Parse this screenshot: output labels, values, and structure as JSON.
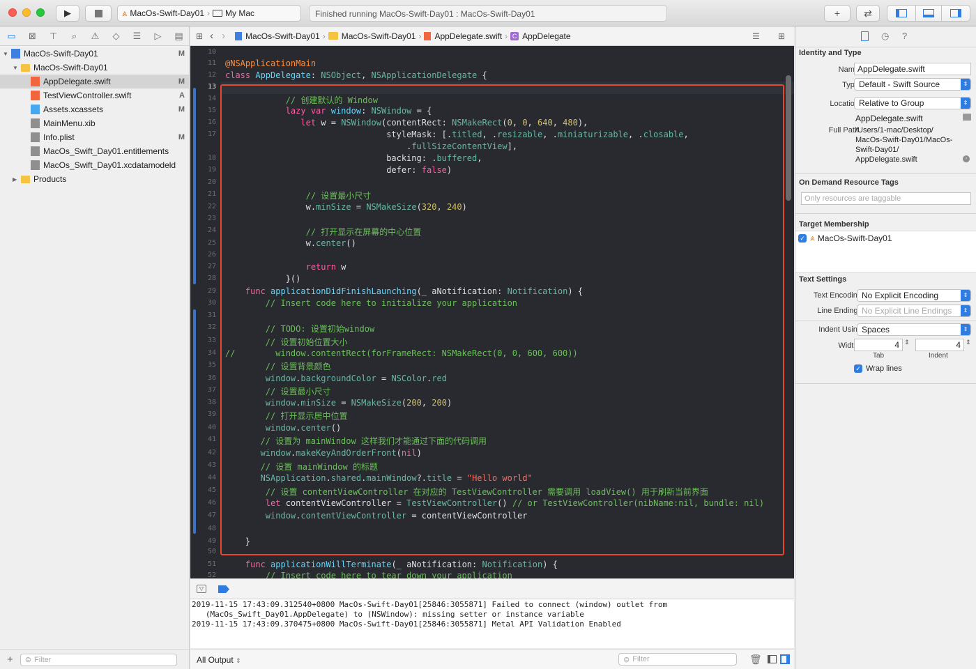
{
  "toolbar": {
    "scheme": "MacOs-Swift-Day01",
    "destination": "My Mac",
    "status": "Finished running MacOs-Swift-Day01 : MacOs-Swift-Day01"
  },
  "navigator": {
    "items": [
      {
        "label": "MacOs-Swift-Day01",
        "badge": "M",
        "indent": 0,
        "icon": "project"
      },
      {
        "label": "MacOs-Swift-Day01",
        "badge": "",
        "indent": 1,
        "icon": "folder"
      },
      {
        "label": "AppDelegate.swift",
        "badge": "M",
        "indent": 2,
        "icon": "swift"
      },
      {
        "label": "TestViewController.swift",
        "badge": "A",
        "indent": 2,
        "icon": "swift"
      },
      {
        "label": "Assets.xcassets",
        "badge": "M",
        "indent": 2,
        "icon": "assets"
      },
      {
        "label": "MainMenu.xib",
        "badge": "",
        "indent": 2,
        "icon": "xib"
      },
      {
        "label": "Info.plist",
        "badge": "M",
        "indent": 2,
        "icon": "plist"
      },
      {
        "label": "MacOs_Swift_Day01.entitlements",
        "badge": "",
        "indent": 2,
        "icon": "file"
      },
      {
        "label": "MacOs_Swift_Day01.xcdatamodeld",
        "badge": "",
        "indent": 2,
        "icon": "file"
      },
      {
        "label": "Products",
        "badge": "",
        "indent": 1,
        "icon": "folder"
      }
    ],
    "filter_placeholder": "Filter"
  },
  "jumpbar": {
    "crumb1": "MacOs-Swift-Day01",
    "crumb2": "MacOs-Swift-Day01",
    "crumb3": "AppDelegate.swift",
    "crumb4": "AppDelegate"
  },
  "code_lines": [
    {
      "n": "10",
      "segs": []
    },
    {
      "n": "11",
      "segs": [
        [
          "a",
          "@NSApplicationMain"
        ]
      ]
    },
    {
      "n": "12",
      "segs": [
        [
          "k",
          "class"
        ],
        [
          "w",
          " "
        ],
        [
          "t",
          "AppDelegate"
        ],
        [
          "w",
          ": "
        ],
        [
          "f",
          "NSObject"
        ],
        [
          "w",
          ", "
        ],
        [
          "f",
          "NSApplicationDelegate"
        ],
        [
          "w",
          " {"
        ]
      ]
    },
    {
      "n": "13",
      "segs": []
    },
    {
      "n": "14",
      "segs": [
        [
          "w",
          "            "
        ],
        [
          "c",
          "// 创建默认的 Window"
        ]
      ]
    },
    {
      "n": "15",
      "segs": [
        [
          "w",
          "            "
        ],
        [
          "k",
          "lazy var"
        ],
        [
          "w",
          " "
        ],
        [
          "t",
          "window"
        ],
        [
          "w",
          ": "
        ],
        [
          "f",
          "NSWindow"
        ],
        [
          "w",
          " = {"
        ]
      ]
    },
    {
      "n": "16",
      "segs": [
        [
          "w",
          "               "
        ],
        [
          "k",
          "let"
        ],
        [
          "w",
          " w = "
        ],
        [
          "f",
          "NSWindow"
        ],
        [
          "w",
          "(contentRect: "
        ],
        [
          "f",
          "NSMakeRect"
        ],
        [
          "w",
          "("
        ],
        [
          "n",
          "0"
        ],
        [
          "w",
          ", "
        ],
        [
          "n",
          "0"
        ],
        [
          "w",
          ", "
        ],
        [
          "n",
          "640"
        ],
        [
          "w",
          ", "
        ],
        [
          "n",
          "480"
        ],
        [
          "w",
          "),"
        ]
      ]
    },
    {
      "n": "17",
      "segs": [
        [
          "w",
          "                                styleMask: [."
        ],
        [
          "f",
          "titled"
        ],
        [
          "w",
          ", ."
        ],
        [
          "f",
          "resizable"
        ],
        [
          "w",
          ", ."
        ],
        [
          "f",
          "miniaturizable"
        ],
        [
          "w",
          ", ."
        ],
        [
          "f",
          "closable"
        ],
        [
          "w",
          ","
        ]
      ]
    },
    {
      "n": "",
      "segs": [
        [
          "w",
          "                                    ."
        ],
        [
          "f",
          "fullSizeContentView"
        ],
        [
          "w",
          "],"
        ]
      ]
    },
    {
      "n": "18",
      "segs": [
        [
          "w",
          "                                backing: ."
        ],
        [
          "f",
          "buffered"
        ],
        [
          "w",
          ","
        ]
      ]
    },
    {
      "n": "19",
      "segs": [
        [
          "w",
          "                                defer: "
        ],
        [
          "k",
          "false"
        ],
        [
          "w",
          ")"
        ]
      ]
    },
    {
      "n": "20",
      "segs": []
    },
    {
      "n": "21",
      "segs": [
        [
          "w",
          "                "
        ],
        [
          "c",
          "// 设置最小尺寸"
        ]
      ]
    },
    {
      "n": "22",
      "segs": [
        [
          "w",
          "                w."
        ],
        [
          "f",
          "minSize"
        ],
        [
          "w",
          " = "
        ],
        [
          "f",
          "NSMakeSize"
        ],
        [
          "w",
          "("
        ],
        [
          "n",
          "320"
        ],
        [
          "w",
          ", "
        ],
        [
          "n",
          "240"
        ],
        [
          "w",
          ")"
        ]
      ]
    },
    {
      "n": "23",
      "segs": []
    },
    {
      "n": "24",
      "segs": [
        [
          "w",
          "                "
        ],
        [
          "c",
          "// 打开显示在屏幕的中心位置"
        ]
      ]
    },
    {
      "n": "25",
      "segs": [
        [
          "w",
          "                w."
        ],
        [
          "f",
          "center"
        ],
        [
          "w",
          "()"
        ]
      ]
    },
    {
      "n": "26",
      "segs": []
    },
    {
      "n": "27",
      "segs": [
        [
          "w",
          "                "
        ],
        [
          "k",
          "return"
        ],
        [
          "w",
          " w"
        ]
      ]
    },
    {
      "n": "28",
      "segs": [
        [
          "w",
          "            }()"
        ]
      ]
    },
    {
      "n": "29",
      "segs": [
        [
          "w",
          "    "
        ],
        [
          "k",
          "func"
        ],
        [
          "w",
          " "
        ],
        [
          "t",
          "applicationDidFinishLaunching"
        ],
        [
          "w",
          "(_ aNotification: "
        ],
        [
          "f",
          "Notification"
        ],
        [
          "w",
          ") {"
        ]
      ]
    },
    {
      "n": "30",
      "segs": [
        [
          "w",
          "        "
        ],
        [
          "c",
          "// Insert code here to initialize your application"
        ]
      ]
    },
    {
      "n": "31",
      "segs": []
    },
    {
      "n": "32",
      "segs": [
        [
          "w",
          "        "
        ],
        [
          "c",
          "// TODO: 设置初始window"
        ]
      ]
    },
    {
      "n": "33",
      "segs": [
        [
          "w",
          "        "
        ],
        [
          "c",
          "// 设置初始位置大小"
        ]
      ]
    },
    {
      "n": "34",
      "segs": [
        [
          "c",
          "//        window.contentRect(forFrameRect: NSMakeRect(0, 0, 600, 600))"
        ]
      ]
    },
    {
      "n": "35",
      "segs": [
        [
          "w",
          "        "
        ],
        [
          "c",
          "// 设置背景颜色"
        ]
      ]
    },
    {
      "n": "36",
      "segs": [
        [
          "w",
          "        "
        ],
        [
          "f",
          "window"
        ],
        [
          "w",
          "."
        ],
        [
          "f",
          "backgroundColor"
        ],
        [
          "w",
          " = "
        ],
        [
          "f",
          "NSColor"
        ],
        [
          "w",
          "."
        ],
        [
          "f",
          "red"
        ]
      ]
    },
    {
      "n": "37",
      "segs": [
        [
          "w",
          "        "
        ],
        [
          "c",
          "// 设置最小尺寸"
        ]
      ]
    },
    {
      "n": "38",
      "segs": [
        [
          "w",
          "        "
        ],
        [
          "f",
          "window"
        ],
        [
          "w",
          "."
        ],
        [
          "f",
          "minSize"
        ],
        [
          "w",
          " = "
        ],
        [
          "f",
          "NSMakeSize"
        ],
        [
          "w",
          "("
        ],
        [
          "n",
          "200"
        ],
        [
          "w",
          ", "
        ],
        [
          "n",
          "200"
        ],
        [
          "w",
          ")"
        ]
      ]
    },
    {
      "n": "39",
      "segs": [
        [
          "w",
          "        "
        ],
        [
          "c",
          "// 打开显示居中位置"
        ]
      ]
    },
    {
      "n": "40",
      "segs": [
        [
          "w",
          "        "
        ],
        [
          "f",
          "window"
        ],
        [
          "w",
          "."
        ],
        [
          "f",
          "center"
        ],
        [
          "w",
          "()"
        ]
      ]
    },
    {
      "n": "41",
      "segs": [
        [
          "w",
          "       "
        ],
        [
          "c",
          "// 设置为 mainWindow 这样我们才能通过下面的代码调用"
        ]
      ]
    },
    {
      "n": "42",
      "segs": [
        [
          "w",
          "       "
        ],
        [
          "f",
          "window"
        ],
        [
          "w",
          "."
        ],
        [
          "f",
          "makeKeyAndOrderFront"
        ],
        [
          "w",
          "("
        ],
        [
          "k",
          "nil"
        ],
        [
          "w",
          ")"
        ]
      ]
    },
    {
      "n": "43",
      "segs": [
        [
          "w",
          "       "
        ],
        [
          "c",
          "// 设置 mainWindow 的标题"
        ]
      ]
    },
    {
      "n": "44",
      "segs": [
        [
          "w",
          "       "
        ],
        [
          "f",
          "NSApplication"
        ],
        [
          "w",
          "."
        ],
        [
          "f",
          "shared"
        ],
        [
          "w",
          "."
        ],
        [
          "f",
          "mainWindow"
        ],
        [
          "w",
          "?."
        ],
        [
          "f",
          "title"
        ],
        [
          "w",
          " = "
        ],
        [
          "s",
          "\"Hello world\""
        ]
      ]
    },
    {
      "n": "45",
      "segs": [
        [
          "w",
          "        "
        ],
        [
          "c",
          "// 设置 contentViewController 在对应的 TestViewController 需要调用 loadView() 用于刷新当前界面"
        ]
      ]
    },
    {
      "n": "46",
      "segs": [
        [
          "w",
          "        "
        ],
        [
          "k",
          "let"
        ],
        [
          "w",
          " contentViewController = "
        ],
        [
          "f",
          "TestViewController"
        ],
        [
          "w",
          "() "
        ],
        [
          "c",
          "// or TestViewController(nibName:nil, bundle: nil)"
        ]
      ]
    },
    {
      "n": "47",
      "segs": [
        [
          "w",
          "        "
        ],
        [
          "f",
          "window"
        ],
        [
          "w",
          "."
        ],
        [
          "f",
          "contentViewController"
        ],
        [
          "w",
          " = contentViewController"
        ]
      ]
    },
    {
      "n": "48",
      "segs": []
    },
    {
      "n": "49",
      "segs": [
        [
          "w",
          "    }"
        ]
      ]
    },
    {
      "n": "50",
      "segs": []
    },
    {
      "n": "51",
      "segs": [
        [
          "w",
          "    "
        ],
        [
          "k",
          "func"
        ],
        [
          "w",
          " "
        ],
        [
          "t",
          "applicationWillTerminate"
        ],
        [
          "w",
          "(_ aNotification: "
        ],
        [
          "f",
          "Notification"
        ],
        [
          "w",
          ") {"
        ]
      ]
    },
    {
      "n": "52",
      "segs": [
        [
          "w",
          "        "
        ],
        [
          "c",
          "// Insert code here to tear down your application"
        ]
      ]
    }
  ],
  "console": {
    "lines": [
      "2019-11-15 17:43:09.312540+0800 MacOs-Swift-Day01[25846:3055871] Failed to connect (window) outlet from",
      "   (MacOs_Swift_Day01.AppDelegate) to (NSWindow): missing setter or instance variable",
      "2019-11-15 17:43:09.370475+0800 MacOs-Swift-Day01[25846:3055871] Metal API Validation Enabled"
    ],
    "output_select": "All Output",
    "filter_placeholder": "Filter"
  },
  "inspector": {
    "identity_title": "Identity and Type",
    "name_label": "Name",
    "name_value": "AppDelegate.swift",
    "type_label": "Type",
    "type_value": "Default - Swift Source",
    "location_label": "Location",
    "location_value": "Relative to Group",
    "location_file": "AppDelegate.swift",
    "fullpath_label": "Full Path",
    "fullpath_lines": [
      "/Users/1-mac/Desktop/",
      "MacOs-Swift-Day01/MacOs-",
      "Swift-Day01/",
      "AppDelegate.swift"
    ],
    "odr_title": "On Demand Resource Tags",
    "odr_placeholder": "Only resources are taggable",
    "target_title": "Target Membership",
    "target_name": "MacOs-Swift-Day01",
    "text_title": "Text Settings",
    "encoding_label": "Text Encoding",
    "encoding_value": "No Explicit Encoding",
    "endings_label": "Line Endings",
    "endings_value": "No Explicit Line Endings",
    "indent_label": "Indent Using",
    "indent_value": "Spaces",
    "widths_label": "Widths",
    "tab_value": "4",
    "indent_width_value": "4",
    "tab_caption": "Tab",
    "indent_caption": "Indent",
    "wrap_label": "Wrap lines"
  },
  "colors": {
    "accent": "#2f7de1",
    "highlight_box": "#e8472b",
    "editor_bg": "#292a30"
  }
}
